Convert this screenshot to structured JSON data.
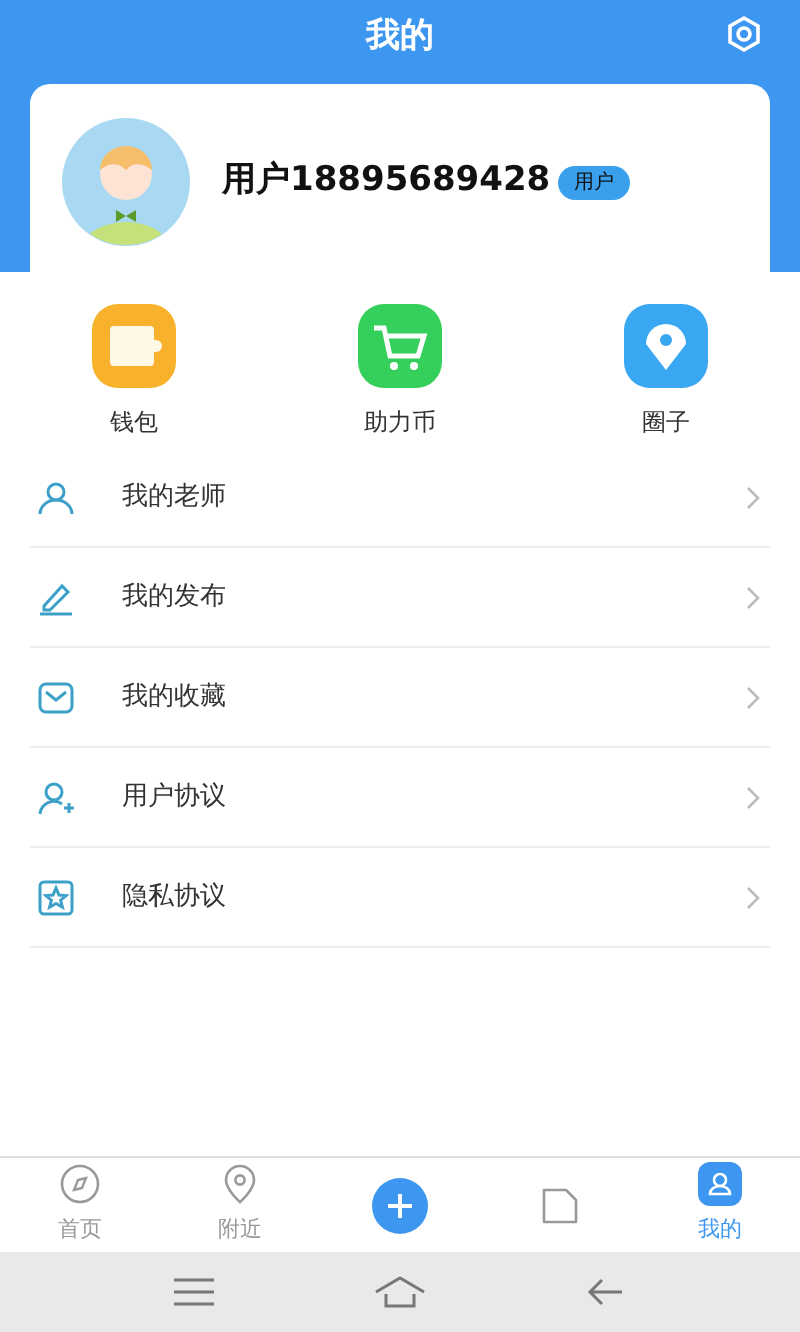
{
  "header": {
    "title": "我的"
  },
  "profile": {
    "name": "用户18895689428",
    "badge": "用户"
  },
  "shortcuts": [
    {
      "label": "钱包",
      "kind": "wallet",
      "color": "#f7b12a"
    },
    {
      "label": "助力币",
      "kind": "cart",
      "color": "#35cf5c"
    },
    {
      "label": "圈子",
      "kind": "pin",
      "color": "#3aa7f2"
    }
  ],
  "menu": [
    {
      "label": "我的老师",
      "kind": "person"
    },
    {
      "label": "我的发布",
      "kind": "pen"
    },
    {
      "label": "我的收藏",
      "kind": "inbox"
    },
    {
      "label": "用户协议",
      "kind": "person-add"
    },
    {
      "label": "隐私协议",
      "kind": "star"
    }
  ],
  "tab_bar": [
    {
      "label": "首页",
      "kind": "compass",
      "selected": false
    },
    {
      "label": "附近",
      "kind": "location",
      "selected": false
    },
    {
      "kind": "plus",
      "selected": false
    },
    {
      "kind": "folder",
      "selected": false
    },
    {
      "label": "我的",
      "kind": "user",
      "selected": true
    }
  ]
}
